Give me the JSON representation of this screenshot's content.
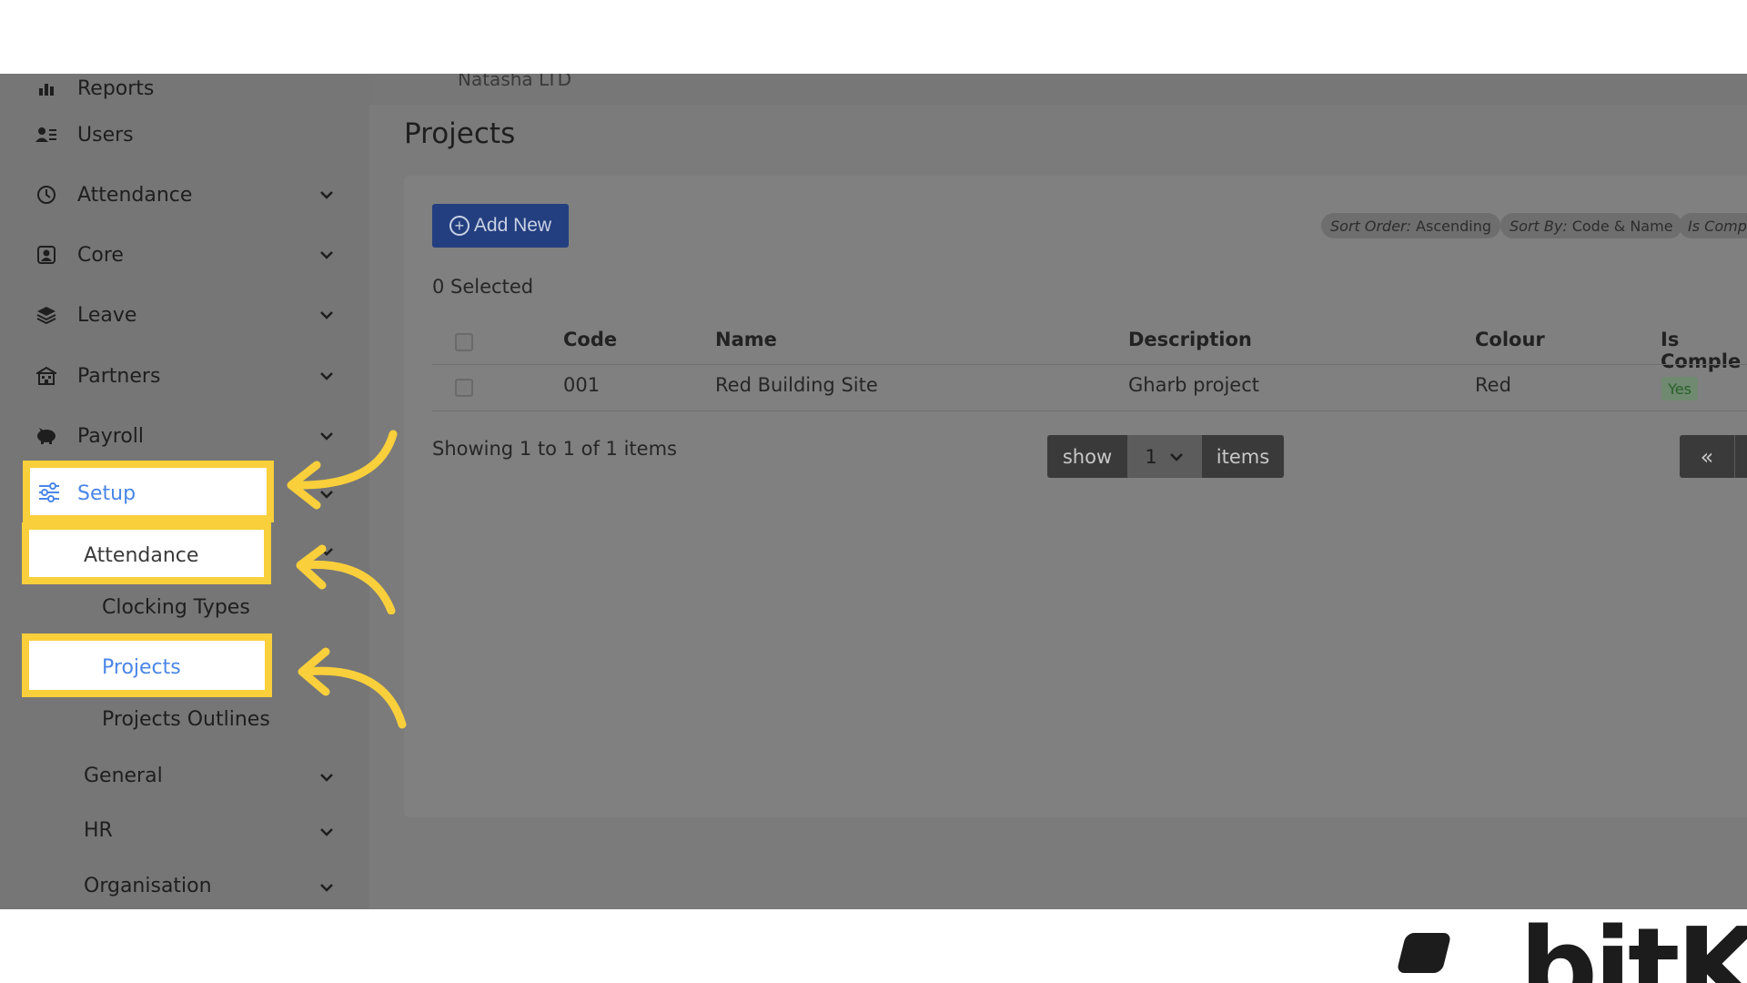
{
  "sidebar": {
    "items": [
      {
        "label": "Reports",
        "icon": "chart-icon"
      },
      {
        "label": "Users",
        "icon": "users-icon"
      },
      {
        "label": "Attendance",
        "icon": "clock-icon"
      },
      {
        "label": "Core",
        "icon": "portrait-icon"
      },
      {
        "label": "Leave",
        "icon": "layers-icon"
      },
      {
        "label": "Partners",
        "icon": "building-icon"
      },
      {
        "label": "Payroll",
        "icon": "piggy-bank-icon"
      },
      {
        "label": "Setup",
        "icon": "sliders-icon"
      }
    ],
    "setup_children": {
      "attendance": "Attendance",
      "clocking_types": "Clocking Types",
      "projects": "Projects",
      "projects_outlines": "Projects Outlines",
      "general": "General",
      "hr": "HR",
      "organisation": "Organisation"
    }
  },
  "header": {
    "company": "Natasha LTD"
  },
  "main": {
    "title": "Projects",
    "add_button": "Add New",
    "filters": [
      {
        "key": "Sort Order:",
        "value": "Ascending"
      },
      {
        "key": "Sort By:",
        "value": "Code & Name"
      },
      {
        "key": "Is Comp",
        "value": ""
      }
    ],
    "selected_text": "0 Selected",
    "table": {
      "headers": [
        "Code",
        "Name",
        "Description",
        "Colour",
        "Is Comple"
      ],
      "rows": [
        {
          "code": "001",
          "name": "Red Building Site",
          "description": "Gharb project",
          "colour": "Red",
          "is_completed": "Yes"
        }
      ]
    },
    "showing_text": "Showing 1 to 1 of 1 items",
    "pager": {
      "show": "show",
      "page_size": "1",
      "items": "items",
      "first": "«"
    }
  },
  "brand": {
    "logo_text": "bitK"
  },
  "colors": {
    "highlight": "#f9cf3b",
    "active_link": "#4a86e8",
    "overlay": "#7b7b7b"
  }
}
